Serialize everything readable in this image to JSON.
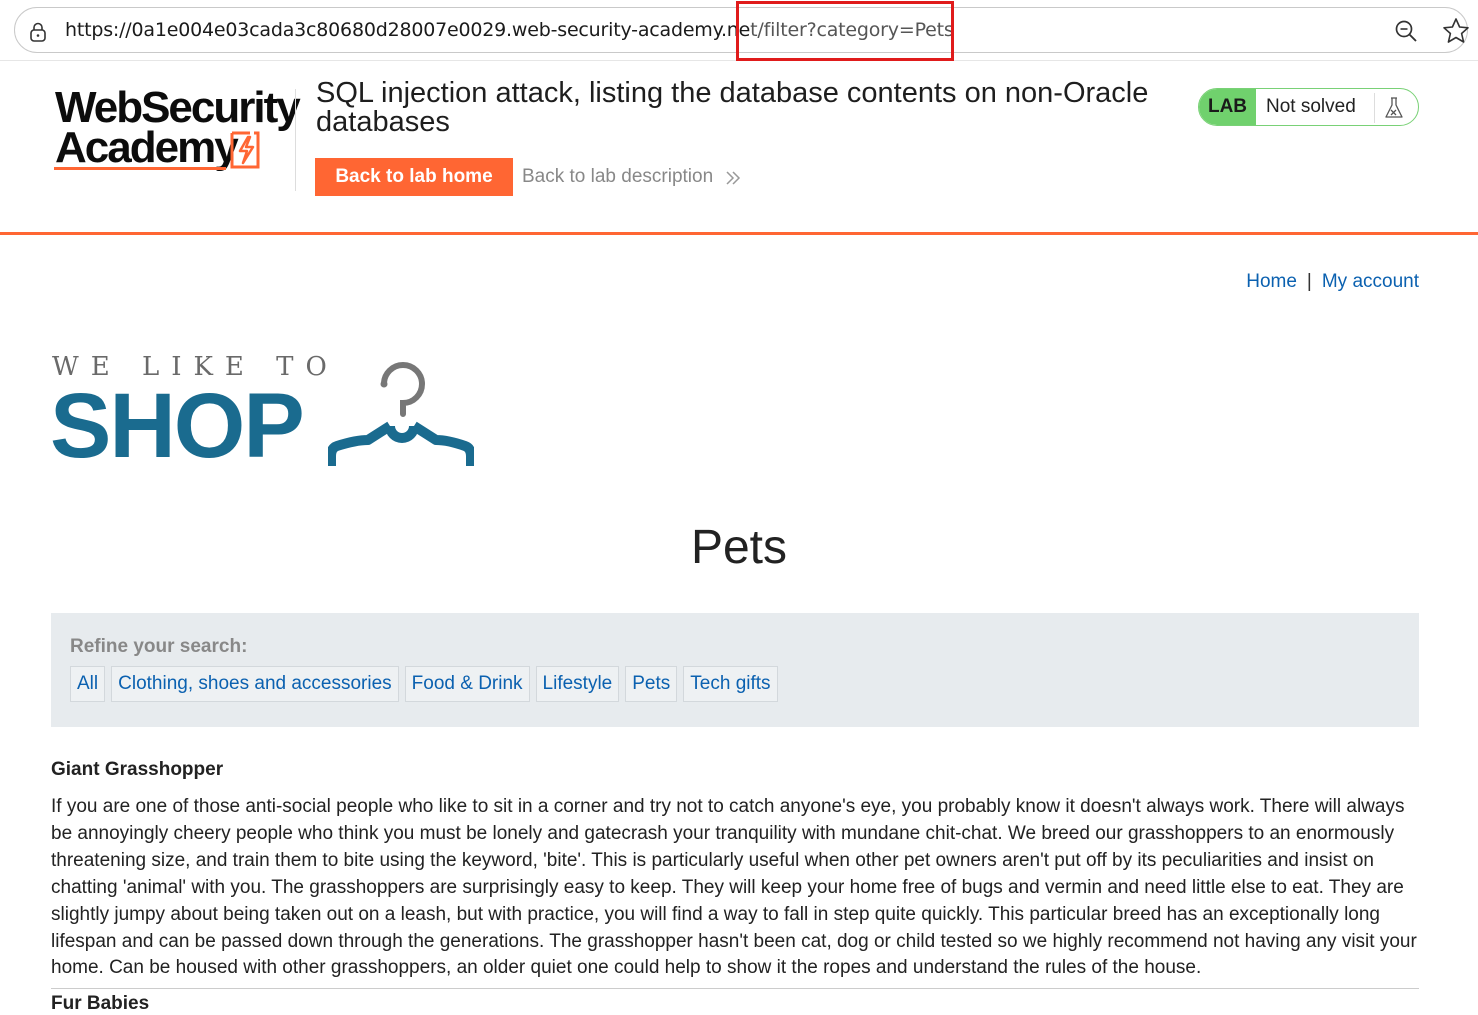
{
  "browser": {
    "url_host": "https://0a1e004e03cada3c80680d28007e0029.web-security-academy.ne",
    "url_path": "t/filter?category=Pets",
    "icons": [
      "lock-icon",
      "zoom-icon",
      "star-icon"
    ]
  },
  "academy": {
    "logo_line1": "WebSecurity",
    "logo_line2": "Academy",
    "lab_title": "SQL injection attack, listing the database contents on non-Oracle databases",
    "back_home_label": "Back to lab home",
    "back_description_label": "Back to lab description",
    "lab_badge": "LAB",
    "lab_state": "Not solved",
    "accent_color": "#ff6633",
    "status_color": "#70d16d"
  },
  "nav": {
    "home": "Home",
    "separator": "|",
    "my_account": "My account"
  },
  "shop_logo": {
    "tagline": "WE LIKE TO",
    "word": "SHOP",
    "brand_color": "#1a6b8f"
  },
  "page": {
    "heading": "Pets"
  },
  "filter": {
    "label": "Refine your search:",
    "categories": [
      "All",
      "Clothing, shoes and accessories",
      "Food & Drink",
      "Lifestyle",
      "Pets",
      "Tech gifts"
    ]
  },
  "product": {
    "title": "Giant Grasshopper",
    "description": "If you are one of those anti-social people who like to sit in a corner and try not to catch anyone's eye, you probably know it doesn't always work. There will always be annoyingly cheery people who think you must be lonely and gatecrash your tranquility with mundane chit-chat. We breed our grasshoppers to an enormously threatening size, and train them to bite using the keyword, 'bite'. This is particularly useful when other pet owners aren't put off by its peculiarities and insist on chatting 'animal' with you. The grasshoppers are surprisingly easy to keep. They will keep your home free of bugs and vermin and need little else to eat. They are slightly jumpy about being taken out on a leash, but with practice, you will find a way to fall in step quite quickly. This particular breed has an exceptionally long lifespan and can be passed down through the generations. The grasshopper hasn't been cat, dog or child tested so we highly recommend not having any visit your home. Can be housed with other grasshoppers, an older quiet one could help to show it the ropes and understand the rules of the house.",
    "next_title": "Fur Babies"
  }
}
